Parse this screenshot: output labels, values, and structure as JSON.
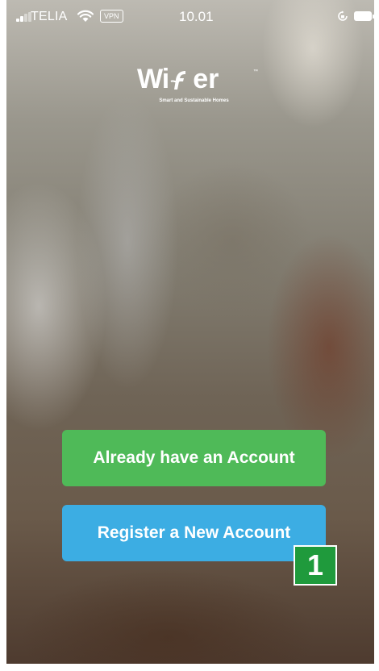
{
  "status_bar": {
    "carrier": "TELIA",
    "vpn_label": "VPN",
    "time": "10.01",
    "icons": [
      "signal-icon",
      "wifi-icon",
      "rotation-lock-icon",
      "battery-icon"
    ]
  },
  "logo": {
    "word_left": "Wi",
    "word_right": "er",
    "trademark": "™",
    "tagline": "Smart and Sustainable Homes"
  },
  "buttons": {
    "login_label": "Already have an Account",
    "register_label": "Register a New Account"
  },
  "annotation": {
    "marker_label": "1"
  },
  "colors": {
    "login_button": "#4fba58",
    "register_button": "#3cade3",
    "marker": "#1f9a3c"
  }
}
